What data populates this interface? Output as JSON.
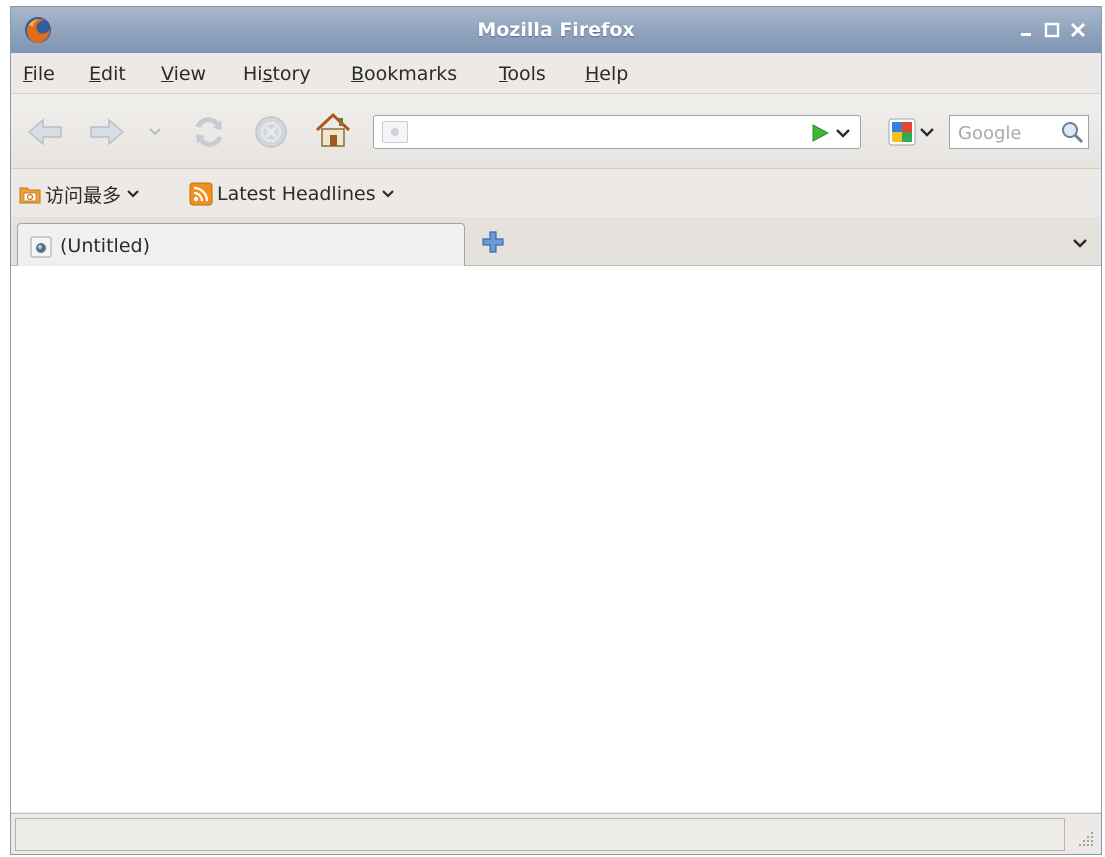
{
  "window": {
    "title": "Mozilla Firefox"
  },
  "menu": [
    {
      "label": "File",
      "accel": "F"
    },
    {
      "label": "Edit",
      "accel": "E"
    },
    {
      "label": "View",
      "accel": "V"
    },
    {
      "label": "History",
      "accel": "s"
    },
    {
      "label": "Bookmarks",
      "accel": "B"
    },
    {
      "label": "Tools",
      "accel": "T"
    },
    {
      "label": "Help",
      "accel": "H"
    }
  ],
  "navbar": {
    "url_value": "",
    "search_placeholder": "Google",
    "icons": [
      "back-arrow-icon",
      "forward-arrow-icon",
      "history-dropdown-icon",
      "reload-icon",
      "stop-icon",
      "home-icon",
      "page-site-icon",
      "go-arrow-icon",
      "url-dropdown-icon",
      "google-engine-icon",
      "magnifier-icon"
    ]
  },
  "bookmarks": [
    {
      "label": "访问最多",
      "icon": "folder-icon"
    },
    {
      "label": "Latest Headlines",
      "icon": "rss-feed-icon"
    }
  ],
  "tabs": [
    {
      "label": "(Untitled)",
      "selected": true
    }
  ],
  "status": {
    "text": ""
  },
  "colors": {
    "titlebar": "#8fa3bd",
    "chrome": "#ece9e6",
    "go_green": "#3fb53a",
    "rss_orange": "#f0901e",
    "new_tab_blue": "#4b7ec2"
  }
}
